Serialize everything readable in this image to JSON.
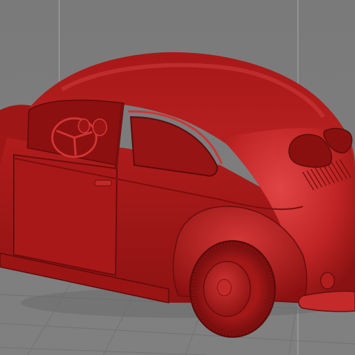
{
  "viewport": {
    "background_color": "#7d7d7d",
    "grid_color": "#6f6f6f",
    "model_color": "#b41c1c",
    "model_highlight_color": "#d83a3a",
    "model_shadow_color": "#6a0c0c",
    "guide_line_color": "#a9a9a9"
  }
}
